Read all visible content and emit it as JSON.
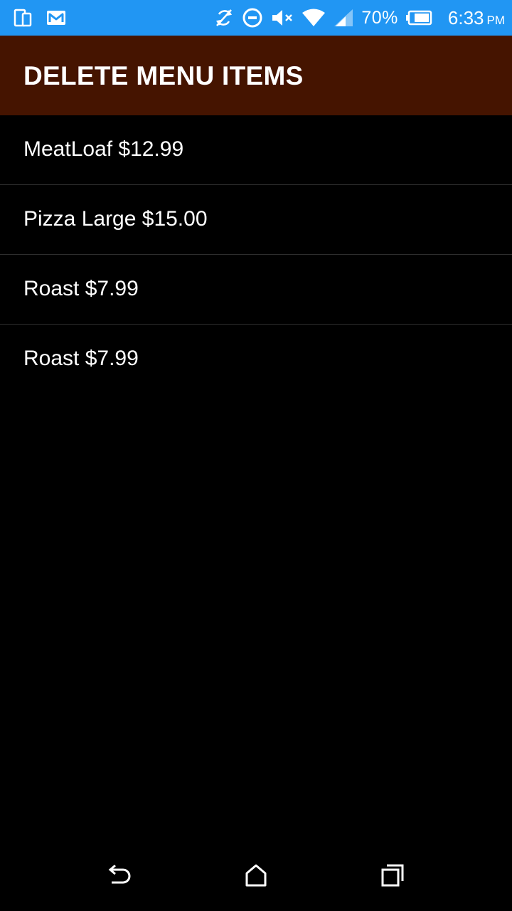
{
  "status_bar": {
    "icons_left": [
      "screen-mirror-icon",
      "gmail-icon"
    ],
    "icons_right": [
      "sync-disabled-icon",
      "do-not-disturb-icon",
      "volume-muted-icon",
      "wifi-icon",
      "cellular-signal-icon",
      "battery-icon"
    ],
    "battery_percent": "70%",
    "time": "6:33",
    "ampm": "PM",
    "color": "#2196F3"
  },
  "action_bar": {
    "title": "DELETE MENU ITEMS",
    "color": "#451400"
  },
  "menu_items": [
    {
      "label": "MeatLoaf $12.99"
    },
    {
      "label": "Pizza Large $15.00"
    },
    {
      "label": "Roast $7.99"
    },
    {
      "label": "Roast $7.99"
    }
  ],
  "nav_bar": {
    "buttons": [
      "back-icon",
      "home-icon",
      "recents-icon"
    ]
  }
}
